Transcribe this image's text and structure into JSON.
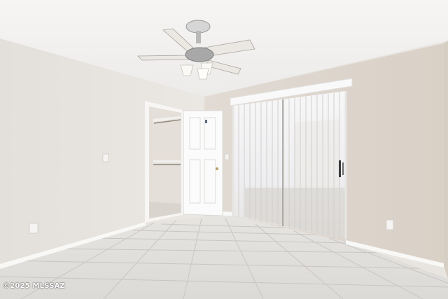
{
  "photo": {
    "watermark": "©2025 MLSSAZ",
    "subjects": [
      "ceiling-fan-icon",
      "closet-door-icon",
      "sliding-door-icon",
      "tile-floor-icon"
    ]
  },
  "colors": {
    "ceiling": "#f4f3f2",
    "left_wall": "#e6e2dd",
    "back_wall": "#ddd6ce",
    "right_wall": "#e0d8cf",
    "floor": "#e3e1de",
    "grout": "#c9c6c2",
    "baseboard": "#f8f8f6",
    "door": "#fbfbfb",
    "blinds": "#f3f3f4"
  }
}
